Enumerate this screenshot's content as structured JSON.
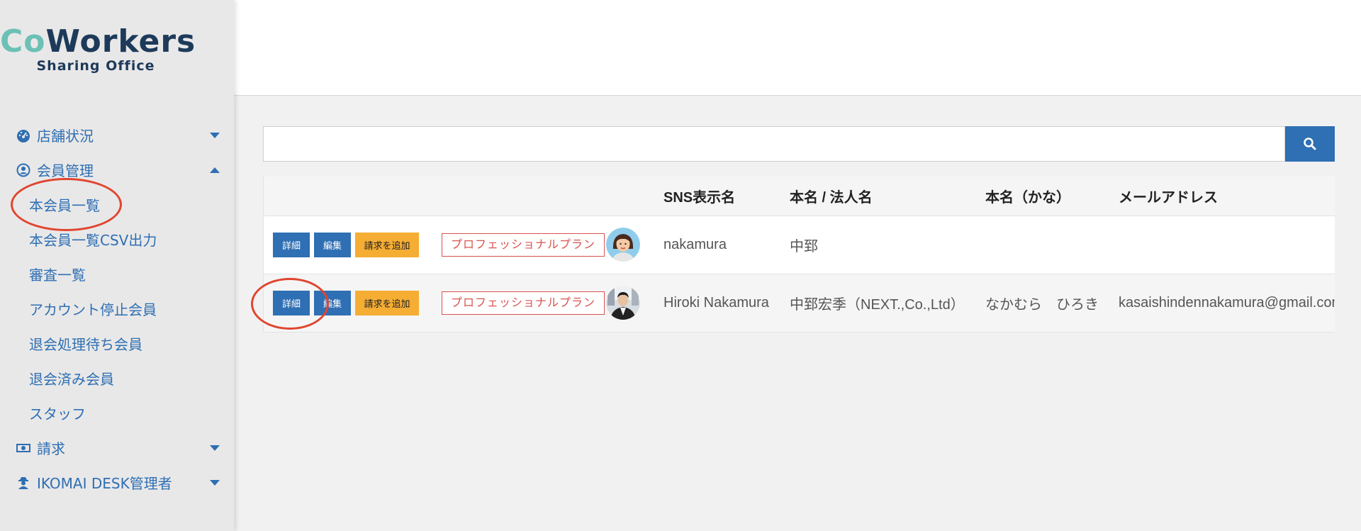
{
  "logo": {
    "title_co": "Co",
    "title_rest": "Workers",
    "subtitle": "Sharing Office"
  },
  "sidebar": {
    "items": [
      {
        "label": "店舗状況",
        "icon": "dashboard-icon",
        "type": "parent",
        "caret": "down"
      },
      {
        "label": "会員管理",
        "icon": "user-circle-icon",
        "type": "parent",
        "caret": "up"
      },
      {
        "label": "本会員一覧",
        "type": "child"
      },
      {
        "label": "本会員一覧CSV出力",
        "type": "child"
      },
      {
        "label": "審査一覧",
        "type": "child"
      },
      {
        "label": "アカウント停止会員",
        "type": "child"
      },
      {
        "label": "退会処理待ち会員",
        "type": "child"
      },
      {
        "label": "退会済み会員",
        "type": "child"
      },
      {
        "label": "スタッフ",
        "type": "child"
      },
      {
        "label": "請求",
        "icon": "money-icon",
        "type": "parent",
        "caret": "down"
      },
      {
        "label": "IKOMAI DESK管理者",
        "icon": "user-secret-icon",
        "type": "parent",
        "caret": "down"
      }
    ]
  },
  "search": {
    "value": "",
    "placeholder": "",
    "button_icon": "search-icon"
  },
  "table": {
    "headers": [
      "",
      "",
      "SNS表示名",
      "本名 / 法人名",
      "本名（かな）",
      "メールアドレス"
    ],
    "buttons": {
      "detail": "詳細",
      "edit": "編集",
      "add_billing": "請求を追加"
    },
    "rows": [
      {
        "plan": "プロフェッショナルプラン",
        "avatar": "female-avatar",
        "sns": "nakamura",
        "name": "中郅",
        "kana": "",
        "email": ""
      },
      {
        "plan": "プロフェッショナルプラン",
        "avatar": "male-photo-avatar",
        "sns": "Hiroki Nakamura",
        "name": "中郅宏季（NEXT.,Co.,Ltd）",
        "kana": "なかむら　ひろき",
        "email": "kasaishindennakamura@gmail.com"
      }
    ]
  },
  "colors": {
    "primary": "#2f6fb3",
    "accent_orange": "#f5ad33",
    "plan_red": "#d9534f",
    "annotation_red": "#e0452f",
    "logo_navy": "#1d3a5a",
    "logo_teal": "#6cc0b5"
  }
}
